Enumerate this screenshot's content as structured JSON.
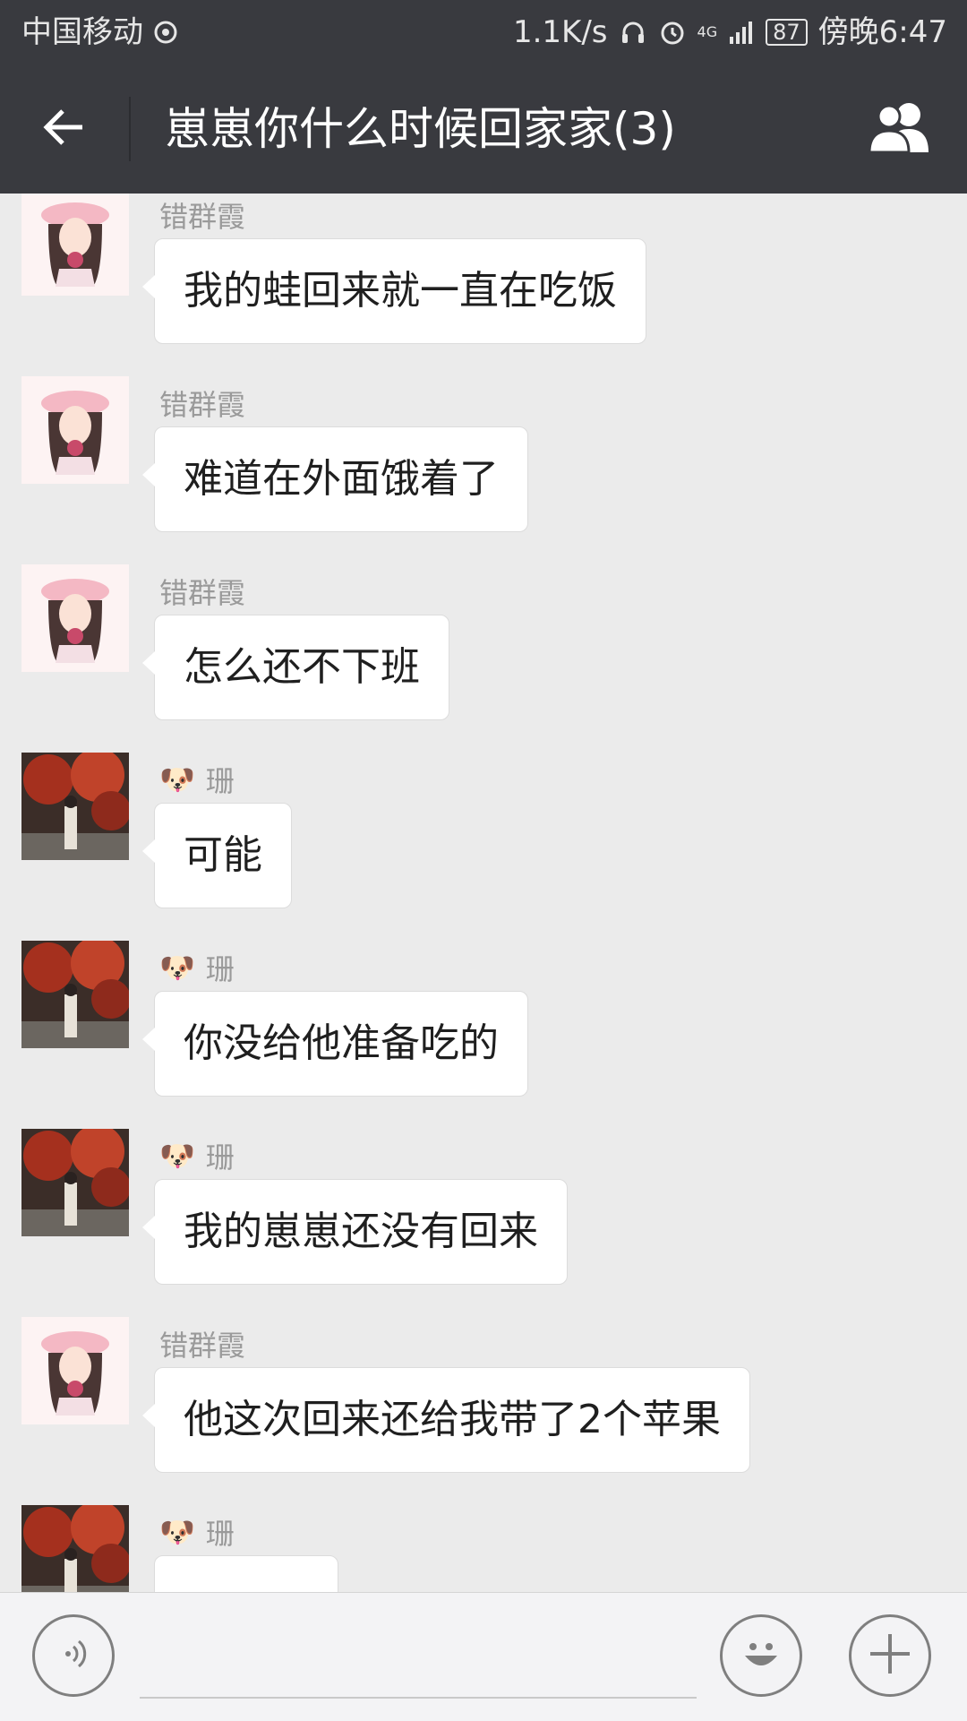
{
  "status_bar": {
    "carrier": "中国移动",
    "speed": "1.1K/s",
    "network": "4G",
    "battery": "87",
    "time": "傍晚6:47"
  },
  "header": {
    "title": "崽崽你什么时候回家家(3)",
    "back_icon": "arrow-left-icon",
    "members_icon": "group-members-icon"
  },
  "messages": [
    {
      "sender": "错群霞",
      "avatar": "anime-girl",
      "text": "我的蛙回来就一直在吃饭",
      "emoji": ""
    },
    {
      "sender": "错群霞",
      "avatar": "anime-girl",
      "text": "难道在外面饿着了",
      "emoji": ""
    },
    {
      "sender": "错群霞",
      "avatar": "anime-girl",
      "text": "怎么还不下班",
      "emoji": ""
    },
    {
      "sender": "珊",
      "avatar": "photo-red-leaves",
      "text": "可能",
      "emoji": "🐶"
    },
    {
      "sender": "珊",
      "avatar": "photo-red-leaves",
      "text": "你没给他准备吃的",
      "emoji": "🐶"
    },
    {
      "sender": "珊",
      "avatar": "photo-red-leaves",
      "text": "我的崽崽还没有回来",
      "emoji": "🐶"
    },
    {
      "sender": "错群霞",
      "avatar": "anime-girl",
      "text": "他这次回来还给我带了2个苹果",
      "emoji": ""
    },
    {
      "sender": "珊",
      "avatar": "photo-red-leaves",
      "text": "",
      "emoji": "🐶"
    }
  ],
  "input_bar": {
    "voice_icon": "voice-icon",
    "emoji_icon": "smiley-icon",
    "plus_icon": "plus-icon",
    "text": ""
  },
  "colors": {
    "header_bg": "#393a3f",
    "chat_bg": "#ebebeb",
    "bubble_bg": "#ffffff"
  }
}
